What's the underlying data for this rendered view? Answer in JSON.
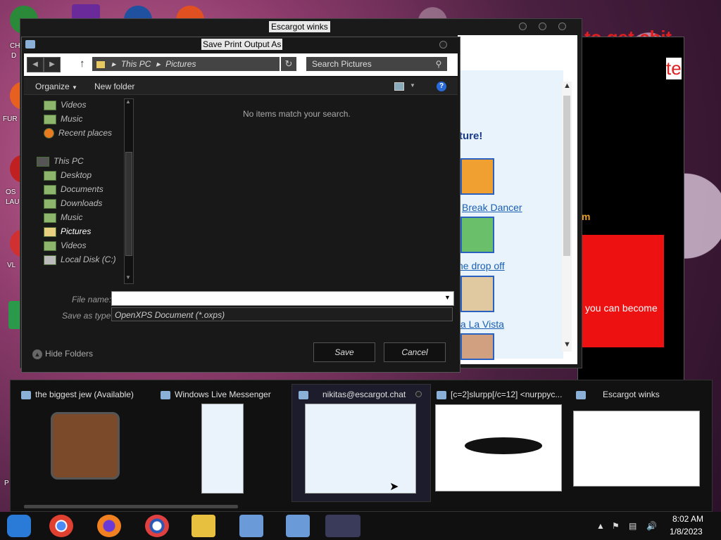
{
  "desktop": {
    "labels": [
      "CH",
      "D",
      "FUR",
      "OS",
      "LAU",
      "VL",
      "P"
    ],
    "bg_text_left": "to get chit",
    "bg_text_right": "te",
    "bg_text_m": "m",
    "red_box_text": "you can become"
  },
  "escargot_window": {
    "title": "Escargot winks",
    "heading": "ture!",
    "links": [
      "Break Dancer",
      "ne drop off",
      "ta La Vista"
    ]
  },
  "dialog": {
    "title": "Save Print Output As",
    "path": [
      "This PC",
      "Pictures"
    ],
    "search_placeholder": "Search Pictures",
    "organize": "Organize",
    "new_folder": "New folder",
    "empty_message": "No items match your search.",
    "nav_items": [
      {
        "label": "Videos"
      },
      {
        "label": "Music"
      },
      {
        "label": "Recent places"
      },
      {
        "label": "This PC"
      },
      {
        "label": "Desktop"
      },
      {
        "label": "Documents"
      },
      {
        "label": "Downloads"
      },
      {
        "label": "Music"
      },
      {
        "label": "Pictures",
        "selected": true
      },
      {
        "label": "Videos"
      },
      {
        "label": "Local Disk (C:)"
      }
    ],
    "file_name_label": "File name:",
    "file_name_value": "",
    "save_type_label": "Save as type:",
    "save_type_value": "OpenXPS Document (*.oxps)",
    "save_button": "Save",
    "cancel_button": "Cancel",
    "hide_folders": "Hide Folders"
  },
  "previews": [
    {
      "title": "the biggest jew (Available)"
    },
    {
      "title": "Windows Live Messenger"
    },
    {
      "title": "nikitas@escargot.chat"
    },
    {
      "title": "[c=2]slurpp[/c=12] <nurppyc..."
    },
    {
      "title": "Escargot winks"
    }
  ],
  "taskbar": {
    "apps": [
      "media-center",
      "chrome",
      "firefox",
      "obama-icon",
      "file-explorer",
      "msn-setup-1",
      "msn-setup-2",
      "messenger"
    ],
    "time": "8:02 AM",
    "date": "1/8/2023"
  },
  "colors": {
    "accent_red": "#ee1111",
    "link_blue": "#1a5fb4"
  }
}
